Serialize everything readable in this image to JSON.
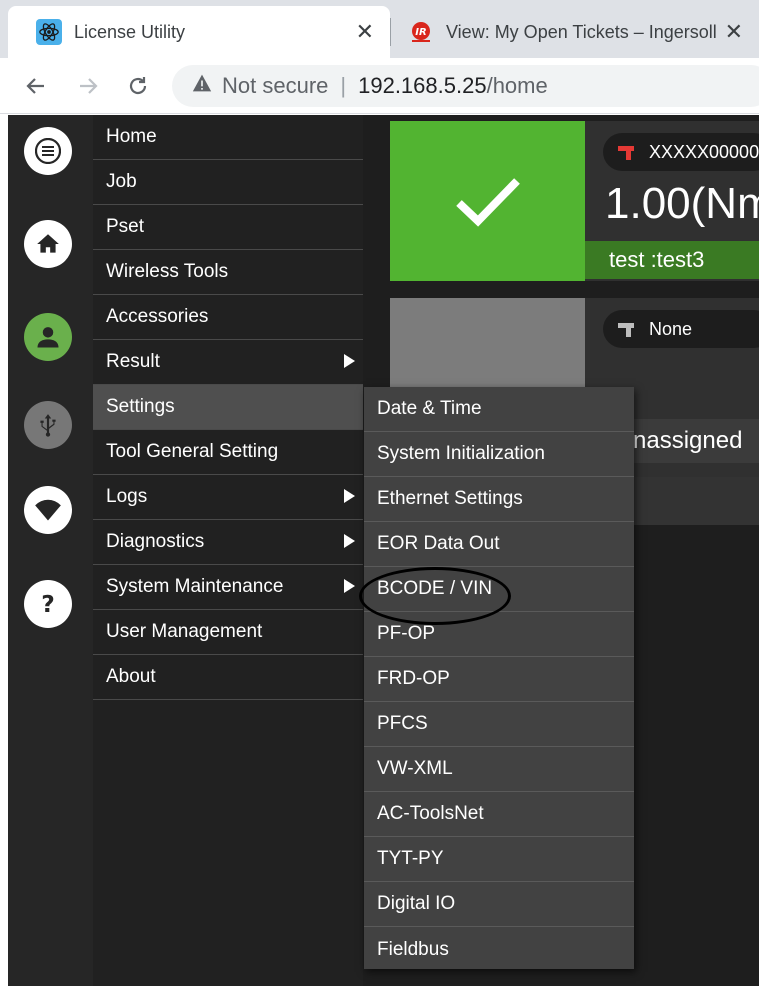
{
  "browser": {
    "tabs": [
      {
        "title": "License Utility",
        "icon": "react-favicon"
      },
      {
        "title": "View: My Open Tickets – Ingersoll",
        "icon": "ingersoll-rand-favicon"
      }
    ],
    "close_glyph": "✕",
    "address": {
      "security_label": "Not secure",
      "host": "192.168.5.25",
      "path": "/home"
    }
  },
  "rail": {
    "icons": [
      "menu-icon",
      "home-icon",
      "user-icon",
      "usb-icon",
      "wifi-icon",
      "help-icon"
    ],
    "colors": {
      "user": "#6ab04c",
      "usb": "#777777",
      "default": "#ffffff"
    }
  },
  "menu": {
    "items": [
      {
        "label": "Home",
        "arrow": false
      },
      {
        "label": "Job",
        "arrow": false
      },
      {
        "label": "Pset",
        "arrow": false
      },
      {
        "label": "Wireless Tools",
        "arrow": false
      },
      {
        "label": "Accessories",
        "arrow": false
      },
      {
        "label": "Result",
        "arrow": true
      },
      {
        "label": "Settings",
        "arrow": false,
        "active": true
      },
      {
        "label": "Tool General Setting",
        "arrow": false
      },
      {
        "label": "Logs",
        "arrow": true
      },
      {
        "label": "Diagnostics",
        "arrow": true
      },
      {
        "label": "System Maintenance",
        "arrow": true
      },
      {
        "label": "User Management",
        "arrow": false
      },
      {
        "label": "About",
        "arrow": false
      }
    ]
  },
  "submenu": {
    "items": [
      "Date & Time",
      "System Initialization",
      "Ethernet Settings",
      "EOR Data Out",
      "BCODE / VIN",
      "PF-OP",
      "FRD-OP",
      "PFCS",
      "VW-XML",
      "AC-ToolsNet",
      "TYT-PY",
      "Digital IO",
      "Fieldbus"
    ]
  },
  "dashboard": {
    "tool1": {
      "name": "XXXXX00000",
      "torque": "1.00(Nm",
      "job": "test :test3",
      "status_color": "#52b431"
    },
    "tool2": {
      "name": "None",
      "assignment": "nassigned",
      "status_color": "#7c7c7c"
    }
  }
}
